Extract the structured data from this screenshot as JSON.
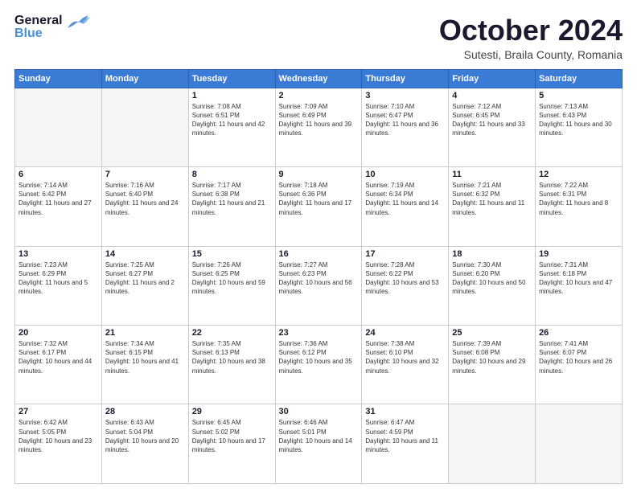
{
  "header": {
    "logo_general": "General",
    "logo_blue": "Blue",
    "month_title": "October 2024",
    "subtitle": "Sutesti, Braila County, Romania"
  },
  "weekdays": [
    "Sunday",
    "Monday",
    "Tuesday",
    "Wednesday",
    "Thursday",
    "Friday",
    "Saturday"
  ],
  "weeks": [
    [
      {
        "day": "",
        "sunrise": "",
        "sunset": "",
        "daylight": "",
        "empty": true
      },
      {
        "day": "",
        "sunrise": "",
        "sunset": "",
        "daylight": "",
        "empty": true
      },
      {
        "day": "1",
        "sunrise": "Sunrise: 7:08 AM",
        "sunset": "Sunset: 6:51 PM",
        "daylight": "Daylight: 11 hours and 42 minutes.",
        "empty": false
      },
      {
        "day": "2",
        "sunrise": "Sunrise: 7:09 AM",
        "sunset": "Sunset: 6:49 PM",
        "daylight": "Daylight: 11 hours and 39 minutes.",
        "empty": false
      },
      {
        "day": "3",
        "sunrise": "Sunrise: 7:10 AM",
        "sunset": "Sunset: 6:47 PM",
        "daylight": "Daylight: 11 hours and 36 minutes.",
        "empty": false
      },
      {
        "day": "4",
        "sunrise": "Sunrise: 7:12 AM",
        "sunset": "Sunset: 6:45 PM",
        "daylight": "Daylight: 11 hours and 33 minutes.",
        "empty": false
      },
      {
        "day": "5",
        "sunrise": "Sunrise: 7:13 AM",
        "sunset": "Sunset: 6:43 PM",
        "daylight": "Daylight: 11 hours and 30 minutes.",
        "empty": false
      }
    ],
    [
      {
        "day": "6",
        "sunrise": "Sunrise: 7:14 AM",
        "sunset": "Sunset: 6:42 PM",
        "daylight": "Daylight: 11 hours and 27 minutes.",
        "empty": false
      },
      {
        "day": "7",
        "sunrise": "Sunrise: 7:16 AM",
        "sunset": "Sunset: 6:40 PM",
        "daylight": "Daylight: 11 hours and 24 minutes.",
        "empty": false
      },
      {
        "day": "8",
        "sunrise": "Sunrise: 7:17 AM",
        "sunset": "Sunset: 6:38 PM",
        "daylight": "Daylight: 11 hours and 21 minutes.",
        "empty": false
      },
      {
        "day": "9",
        "sunrise": "Sunrise: 7:18 AM",
        "sunset": "Sunset: 6:36 PM",
        "daylight": "Daylight: 11 hours and 17 minutes.",
        "empty": false
      },
      {
        "day": "10",
        "sunrise": "Sunrise: 7:19 AM",
        "sunset": "Sunset: 6:34 PM",
        "daylight": "Daylight: 11 hours and 14 minutes.",
        "empty": false
      },
      {
        "day": "11",
        "sunrise": "Sunrise: 7:21 AM",
        "sunset": "Sunset: 6:32 PM",
        "daylight": "Daylight: 11 hours and 11 minutes.",
        "empty": false
      },
      {
        "day": "12",
        "sunrise": "Sunrise: 7:22 AM",
        "sunset": "Sunset: 6:31 PM",
        "daylight": "Daylight: 11 hours and 8 minutes.",
        "empty": false
      }
    ],
    [
      {
        "day": "13",
        "sunrise": "Sunrise: 7:23 AM",
        "sunset": "Sunset: 6:29 PM",
        "daylight": "Daylight: 11 hours and 5 minutes.",
        "empty": false
      },
      {
        "day": "14",
        "sunrise": "Sunrise: 7:25 AM",
        "sunset": "Sunset: 6:27 PM",
        "daylight": "Daylight: 11 hours and 2 minutes.",
        "empty": false
      },
      {
        "day": "15",
        "sunrise": "Sunrise: 7:26 AM",
        "sunset": "Sunset: 6:25 PM",
        "daylight": "Daylight: 10 hours and 59 minutes.",
        "empty": false
      },
      {
        "day": "16",
        "sunrise": "Sunrise: 7:27 AM",
        "sunset": "Sunset: 6:23 PM",
        "daylight": "Daylight: 10 hours and 56 minutes.",
        "empty": false
      },
      {
        "day": "17",
        "sunrise": "Sunrise: 7:28 AM",
        "sunset": "Sunset: 6:22 PM",
        "daylight": "Daylight: 10 hours and 53 minutes.",
        "empty": false
      },
      {
        "day": "18",
        "sunrise": "Sunrise: 7:30 AM",
        "sunset": "Sunset: 6:20 PM",
        "daylight": "Daylight: 10 hours and 50 minutes.",
        "empty": false
      },
      {
        "day": "19",
        "sunrise": "Sunrise: 7:31 AM",
        "sunset": "Sunset: 6:18 PM",
        "daylight": "Daylight: 10 hours and 47 minutes.",
        "empty": false
      }
    ],
    [
      {
        "day": "20",
        "sunrise": "Sunrise: 7:32 AM",
        "sunset": "Sunset: 6:17 PM",
        "daylight": "Daylight: 10 hours and 44 minutes.",
        "empty": false
      },
      {
        "day": "21",
        "sunrise": "Sunrise: 7:34 AM",
        "sunset": "Sunset: 6:15 PM",
        "daylight": "Daylight: 10 hours and 41 minutes.",
        "empty": false
      },
      {
        "day": "22",
        "sunrise": "Sunrise: 7:35 AM",
        "sunset": "Sunset: 6:13 PM",
        "daylight": "Daylight: 10 hours and 38 minutes.",
        "empty": false
      },
      {
        "day": "23",
        "sunrise": "Sunrise: 7:36 AM",
        "sunset": "Sunset: 6:12 PM",
        "daylight": "Daylight: 10 hours and 35 minutes.",
        "empty": false
      },
      {
        "day": "24",
        "sunrise": "Sunrise: 7:38 AM",
        "sunset": "Sunset: 6:10 PM",
        "daylight": "Daylight: 10 hours and 32 minutes.",
        "empty": false
      },
      {
        "day": "25",
        "sunrise": "Sunrise: 7:39 AM",
        "sunset": "Sunset: 6:08 PM",
        "daylight": "Daylight: 10 hours and 29 minutes.",
        "empty": false
      },
      {
        "day": "26",
        "sunrise": "Sunrise: 7:41 AM",
        "sunset": "Sunset: 6:07 PM",
        "daylight": "Daylight: 10 hours and 26 minutes.",
        "empty": false
      }
    ],
    [
      {
        "day": "27",
        "sunrise": "Sunrise: 6:42 AM",
        "sunset": "Sunset: 5:05 PM",
        "daylight": "Daylight: 10 hours and 23 minutes.",
        "empty": false
      },
      {
        "day": "28",
        "sunrise": "Sunrise: 6:43 AM",
        "sunset": "Sunset: 5:04 PM",
        "daylight": "Daylight: 10 hours and 20 minutes.",
        "empty": false
      },
      {
        "day": "29",
        "sunrise": "Sunrise: 6:45 AM",
        "sunset": "Sunset: 5:02 PM",
        "daylight": "Daylight: 10 hours and 17 minutes.",
        "empty": false
      },
      {
        "day": "30",
        "sunrise": "Sunrise: 6:46 AM",
        "sunset": "Sunset: 5:01 PM",
        "daylight": "Daylight: 10 hours and 14 minutes.",
        "empty": false
      },
      {
        "day": "31",
        "sunrise": "Sunrise: 6:47 AM",
        "sunset": "Sunset: 4:59 PM",
        "daylight": "Daylight: 10 hours and 11 minutes.",
        "empty": false
      },
      {
        "day": "",
        "sunrise": "",
        "sunset": "",
        "daylight": "",
        "empty": true
      },
      {
        "day": "",
        "sunrise": "",
        "sunset": "",
        "daylight": "",
        "empty": true
      }
    ]
  ]
}
